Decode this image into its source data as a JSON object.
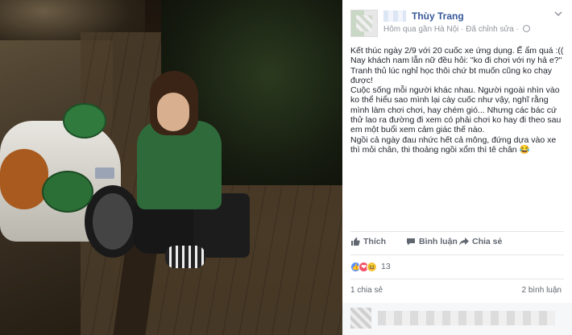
{
  "post": {
    "author": "Thùy Trang",
    "meta_text": "Hôm qua gần Hà Nội · Đã chỉnh sửa ·",
    "menu_icon": "chevron-down-icon",
    "body": [
      "Kết thúc ngày 2/9 với 20 cuốc xe ứng dụng. Ế ẩm quá :((",
      "Nay khách nam lẫn nữ đều hỏi: \"ko đi chơi với ny hả e?\"",
      "Tranh thủ lúc nghỉ học thôi chứ bt muốn cũng ko chạy được!",
      "Cuộc sống mỗi người khác nhau. Người ngoài nhìn vào ko thể hiểu sao mình lại cày cuốc như vậy, nghĩ rằng mình làm chơi chơi, hay chém gió... Nhưng các bác cứ thử lao ra đường đi xem có phải chơi ko hay đi theo sau em một buổi xem cảm giác thế nào.",
      "Ngồi cả ngày đau nhức hết cả mông, đứng dựa vào xe thì mỏi chân, thi thoảng ngồi xổm thì tê chân 😂"
    ]
  },
  "actions": {
    "like_label": "Thích",
    "comment_label": "Bình luận",
    "share_label": "Chia sẻ"
  },
  "reactions": {
    "count": "13",
    "types": [
      "like",
      "love",
      "haha"
    ],
    "like_glyph": "👍",
    "love_glyph": "❤",
    "haha_glyph": "😆"
  },
  "stats": {
    "shares": "1 chia sẻ",
    "comments": "2 bình luận"
  },
  "colors": {
    "author_link": "#365899",
    "like_blue": "#5890ff",
    "love_red": "#f25268",
    "haha_yellow": "#f7c945"
  }
}
